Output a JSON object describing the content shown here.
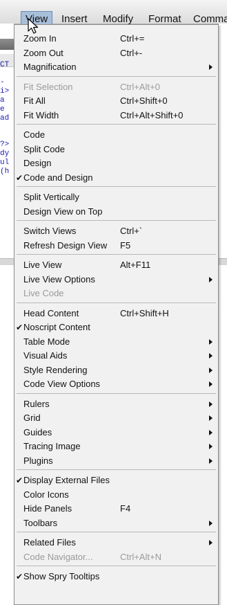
{
  "menubar": {
    "items": [
      "View",
      "Insert",
      "Modify",
      "Format",
      "Comma"
    ]
  },
  "background_code": [
    "CT",
    "-",
    "i>",
    "a",
    "e",
    "ad",
    "?>",
    "dy",
    "ul",
    "(h"
  ],
  "menu": {
    "groups": [
      [
        {
          "label": "Zoom In",
          "shortcut": "Ctrl+="
        },
        {
          "label": "Zoom Out",
          "shortcut": "Ctrl+-"
        },
        {
          "label": "Magnification",
          "submenu": true
        }
      ],
      [
        {
          "label": "Fit Selection",
          "shortcut": "Ctrl+Alt+0",
          "disabled": true
        },
        {
          "label": "Fit All",
          "shortcut": "Ctrl+Shift+0"
        },
        {
          "label": "Fit Width",
          "shortcut": "Ctrl+Alt+Shift+0"
        }
      ],
      [
        {
          "label": "Code"
        },
        {
          "label": "Split Code"
        },
        {
          "label": "Design"
        },
        {
          "label": "Code and Design",
          "checked": true
        }
      ],
      [
        {
          "label": "Split Vertically"
        },
        {
          "label": "Design View on Top"
        }
      ],
      [
        {
          "label": "Switch Views",
          "shortcut": "Ctrl+`"
        },
        {
          "label": "Refresh Design View",
          "shortcut": "F5"
        }
      ],
      [
        {
          "label": "Live View",
          "shortcut": "Alt+F11"
        },
        {
          "label": "Live View Options",
          "submenu": true
        },
        {
          "label": "Live Code",
          "disabled": true
        }
      ],
      [
        {
          "label": "Head Content",
          "shortcut": "Ctrl+Shift+H"
        },
        {
          "label": "Noscript Content",
          "checked": true
        },
        {
          "label": "Table Mode",
          "submenu": true
        },
        {
          "label": "Visual Aids",
          "submenu": true
        },
        {
          "label": "Style Rendering",
          "submenu": true
        },
        {
          "label": "Code View Options",
          "submenu": true
        }
      ],
      [
        {
          "label": "Rulers",
          "submenu": true
        },
        {
          "label": "Grid",
          "submenu": true
        },
        {
          "label": "Guides",
          "submenu": true
        },
        {
          "label": "Tracing Image",
          "submenu": true
        },
        {
          "label": "Plugins",
          "submenu": true
        }
      ],
      [
        {
          "label": "Display External Files",
          "checked": true
        },
        {
          "label": "Color Icons"
        },
        {
          "label": "Hide Panels",
          "shortcut": "F4"
        },
        {
          "label": "Toolbars",
          "submenu": true
        }
      ],
      [
        {
          "label": "Related Files",
          "submenu": true
        },
        {
          "label": "Code Navigator...",
          "shortcut": "Ctrl+Alt+N",
          "disabled": true
        }
      ],
      [
        {
          "label": "Show Spry Tooltips",
          "checked": true
        }
      ]
    ]
  }
}
